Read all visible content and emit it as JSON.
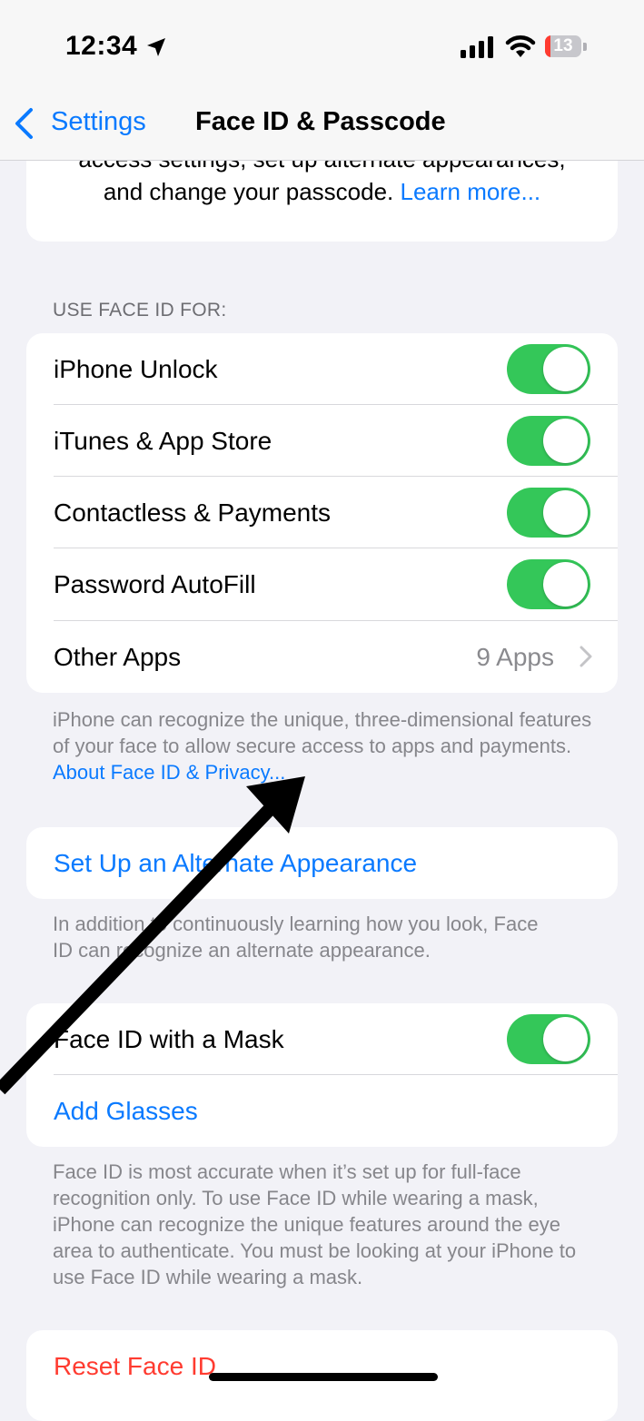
{
  "status_bar": {
    "time": "12:34",
    "battery_level": "13",
    "icons": [
      "location-arrow-icon",
      "cellular-signal-icon",
      "wifi-icon",
      "battery-icon"
    ]
  },
  "nav": {
    "back_label": "Settings",
    "title": "Face ID & Passcode"
  },
  "intro": {
    "partial_line": "access settings, set up alternate appearances,",
    "line": "and change your passcode.",
    "link": "Learn more..."
  },
  "use_face_id": {
    "header": "USE FACE ID FOR:",
    "rows": [
      {
        "label": "iPhone Unlock",
        "on": true
      },
      {
        "label": "iTunes & App Store",
        "on": true
      },
      {
        "label": "Contactless & Payments",
        "on": true
      },
      {
        "label": "Password AutoFill",
        "on": true
      }
    ],
    "other_apps": {
      "label": "Other Apps",
      "value": "9 Apps"
    },
    "footer_text": "iPhone can recognize the unique, three-dimensional features of your face to allow secure access to apps and payments.",
    "footer_link": "About Face ID & Privacy..."
  },
  "alternate": {
    "label": "Set Up an Alternate Appearance",
    "footer": "In addition to continuously learning how you look, Face ID can recognize an alternate appearance."
  },
  "mask": {
    "label": "Face ID with a Mask",
    "on": true,
    "glasses_label": "Add Glasses",
    "footer": "Face ID is most accurate when it’s set up for full-face recognition only. To use Face ID while wearing a mask, iPhone can recognize the unique features around the eye area to authenticate. You must be looking at your iPhone to use Face ID while wearing a mask."
  },
  "reset": {
    "label": "Reset Face ID"
  },
  "colors": {
    "accent": "#0a7aff",
    "toggle_on": "#34c759",
    "destructive": "#ff3b30",
    "background": "#f2f2f7"
  }
}
